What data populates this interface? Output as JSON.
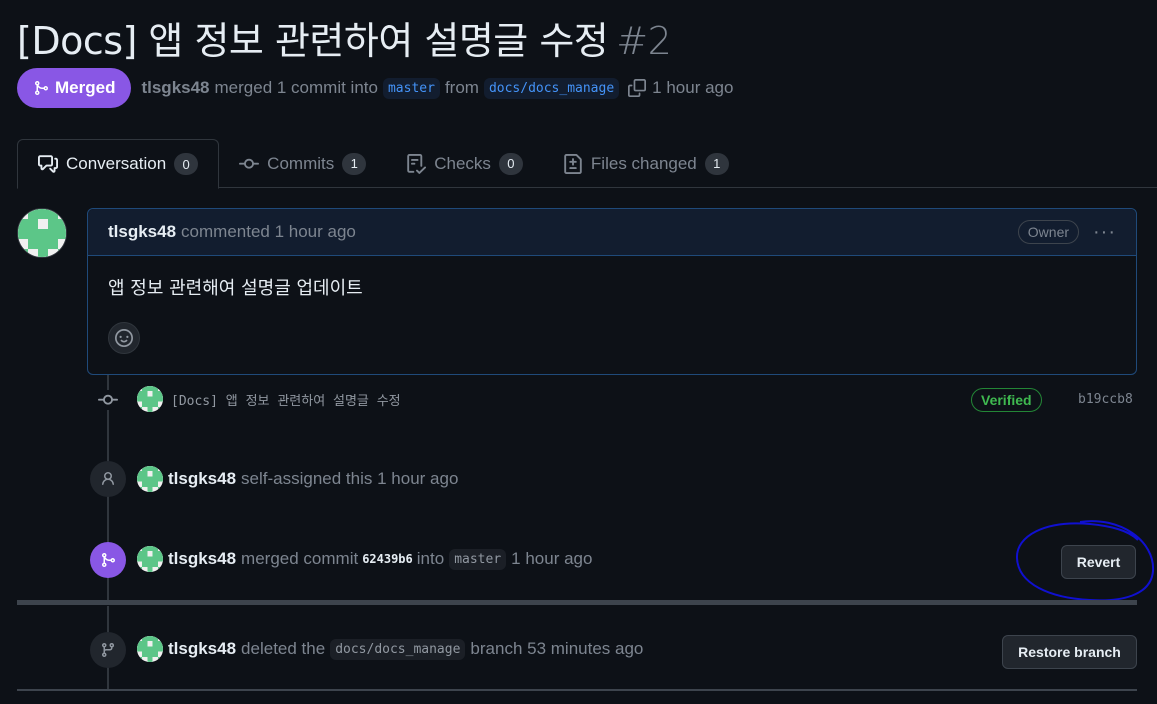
{
  "pr": {
    "title": "[Docs] 앱 정보 관련하여 설명글 수정",
    "number": "#2",
    "state_label": "Merged",
    "author": "tlsgks48",
    "merge_text": "merged 1 commit into",
    "base_branch": "master",
    "from_text": "from",
    "head_branch": "docs/docs_manage",
    "time": "1 hour ago"
  },
  "tabs": [
    {
      "label": "Conversation",
      "count": "0"
    },
    {
      "label": "Commits",
      "count": "1"
    },
    {
      "label": "Checks",
      "count": "0"
    },
    {
      "label": "Files changed",
      "count": "1"
    }
  ],
  "comment": {
    "author": "tlsgks48",
    "action": "commented 1 hour ago",
    "role_badge": "Owner",
    "menu": "···",
    "body": "앱 정보 관련해여 설명글 업데이트"
  },
  "commit": {
    "message": "[Docs] 앱 정보 관련하여 설명글 수정",
    "verified_label": "Verified",
    "sha": "b19ccb8"
  },
  "events": {
    "assigned": {
      "author": "tlsgks48",
      "text": "self-assigned this 1 hour ago"
    },
    "merged": {
      "author": "tlsgks48",
      "text1": "merged commit",
      "commit": "62439b6",
      "text2": "into",
      "branch": "master",
      "time": "1 hour ago",
      "button": "Revert"
    },
    "deleted": {
      "author": "tlsgks48",
      "text1": "deleted the",
      "branch": "docs/docs_manage",
      "text2": "branch 53 minutes ago",
      "button": "Restore branch"
    }
  },
  "colors": {
    "merged_purple": "#8957e5",
    "link_blue": "#4493f8",
    "verified_green": "#3fb950",
    "annotation_blue": "#1010d0"
  }
}
